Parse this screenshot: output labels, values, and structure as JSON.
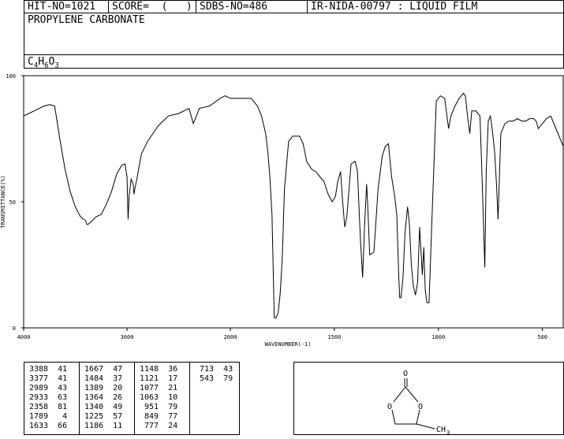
{
  "header": {
    "hit_no": "HIT-NO=1021",
    "score": "SCORE=  (   )",
    "sdbs_no": "SDBS-NO=486",
    "ir_info": "IR-NIDA-00797 : LIQUID FILM"
  },
  "compound": {
    "name": "PROPYLENE CARBONATE",
    "formula_parts": [
      {
        "text": "C",
        "sub": false
      },
      {
        "text": "4",
        "sub": true
      },
      {
        "text": "H",
        "sub": false
      },
      {
        "text": "6",
        "sub": true
      },
      {
        "text": "O",
        "sub": false
      },
      {
        "text": "3",
        "sub": true
      }
    ]
  },
  "chart_data": {
    "type": "line",
    "xlabel": "WAVENUMBER(-1)",
    "ylabel": "TRANSMITTANCE(%)",
    "xlim": [
      4000,
      400
    ],
    "ylim": [
      0,
      100
    ],
    "x_ticks": [
      4000,
      3000,
      2000,
      1500,
      1000,
      500
    ],
    "y_ticks": [
      0,
      50,
      100
    ],
    "grid": false,
    "series": [
      {
        "x": [
          4000,
          3950,
          3900,
          3850,
          3800,
          3750,
          3700,
          3650,
          3600,
          3550,
          3500,
          3450,
          3400,
          3388,
          3377,
          3350,
          3300,
          3250,
          3200,
          3150,
          3100,
          3050,
          3020,
          3000,
          2989,
          2980,
          2960,
          2940,
          2933,
          2920,
          2900,
          2860,
          2800,
          2700,
          2600,
          2500,
          2400,
          2358,
          2300,
          2200,
          2100,
          2050,
          2000,
          1950,
          1900,
          1870,
          1850,
          1830,
          1820,
          1810,
          1800,
          1789,
          1780,
          1770,
          1760,
          1750,
          1740,
          1720,
          1700,
          1680,
          1667,
          1650,
          1633,
          1610,
          1590,
          1570,
          1550,
          1530,
          1510,
          1495,
          1484,
          1470,
          1460,
          1450,
          1440,
          1420,
          1400,
          1389,
          1380,
          1374,
          1364,
          1355,
          1345,
          1340,
          1330,
          1310,
          1290,
          1270,
          1255,
          1240,
          1225,
          1210,
          1200,
          1190,
          1186,
          1180,
          1170,
          1160,
          1148,
          1140,
          1130,
          1121,
          1110,
          1100,
          1090,
          1077,
          1070,
          1063,
          1055,
          1045,
          1030,
          1010,
          990,
          970,
          951,
          940,
          920,
          900,
          880,
          870,
          860,
          849,
          840,
          820,
          800,
          790,
          777,
          770,
          760,
          750,
          740,
          730,
          720,
          713,
          700,
          680,
          660,
          640,
          620,
          600,
          580,
          560,
          543,
          530,
          520,
          500,
          480,
          460,
          440,
          420,
          400
        ],
        "y": [
          84,
          85,
          86,
          87,
          88,
          88.5,
          88,
          75,
          63,
          54,
          48,
          44,
          42.5,
          41,
          41,
          42,
          44,
          45,
          49,
          54,
          61,
          64.5,
          65,
          60,
          43,
          52,
          59,
          57,
          53,
          56,
          60,
          69,
          74,
          80,
          84,
          85,
          87,
          81,
          87,
          88,
          91,
          92,
          91,
          91,
          91,
          88,
          84,
          77,
          70,
          60,
          45,
          4,
          4,
          6,
          14,
          28,
          55,
          74,
          76,
          76,
          76,
          73,
          66,
          63,
          62,
          60,
          58,
          53,
          50,
          52,
          58,
          62,
          50,
          40,
          44,
          65,
          66,
          62,
          45,
          34,
          20,
          40,
          57,
          49,
          29,
          30,
          55,
          68,
          72,
          73,
          60,
          52,
          45,
          20,
          12,
          12,
          20,
          38,
          48,
          42,
          25,
          17,
          13,
          18,
          40,
          21,
          32,
          15,
          10,
          10,
          45,
          90,
          92,
          91,
          79,
          84,
          88,
          91,
          93,
          92,
          84,
          77,
          86,
          86,
          84,
          60,
          24,
          62,
          82,
          84,
          78,
          70,
          56,
          43,
          77,
          81,
          82,
          82,
          83,
          82,
          82,
          83,
          83,
          82,
          79,
          81,
          83,
          84,
          80,
          76,
          72
        ]
      }
    ]
  },
  "peak_table": {
    "columns": [
      [
        "3388  41",
        "3377  41",
        "2989  43",
        "2933  63",
        "2358  81",
        "1789   4",
        "1633  66"
      ],
      [
        "1667  47",
        "1484  37",
        "1389  20",
        "1364  26",
        "1340  49",
        "1225  57",
        "1186  11"
      ],
      [
        "1148  36",
        "1121  17",
        "1077  21",
        "1063  10",
        " 951  79",
        " 849  77",
        " 777  24"
      ],
      [
        " 713  43",
        " 543  79"
      ]
    ]
  },
  "structure": {
    "atoms": {
      "carbonyl_o": "O",
      "ring_o_left": "O",
      "ring_o_right": "O",
      "methyl": "CH",
      "methyl_sub": "3"
    }
  }
}
